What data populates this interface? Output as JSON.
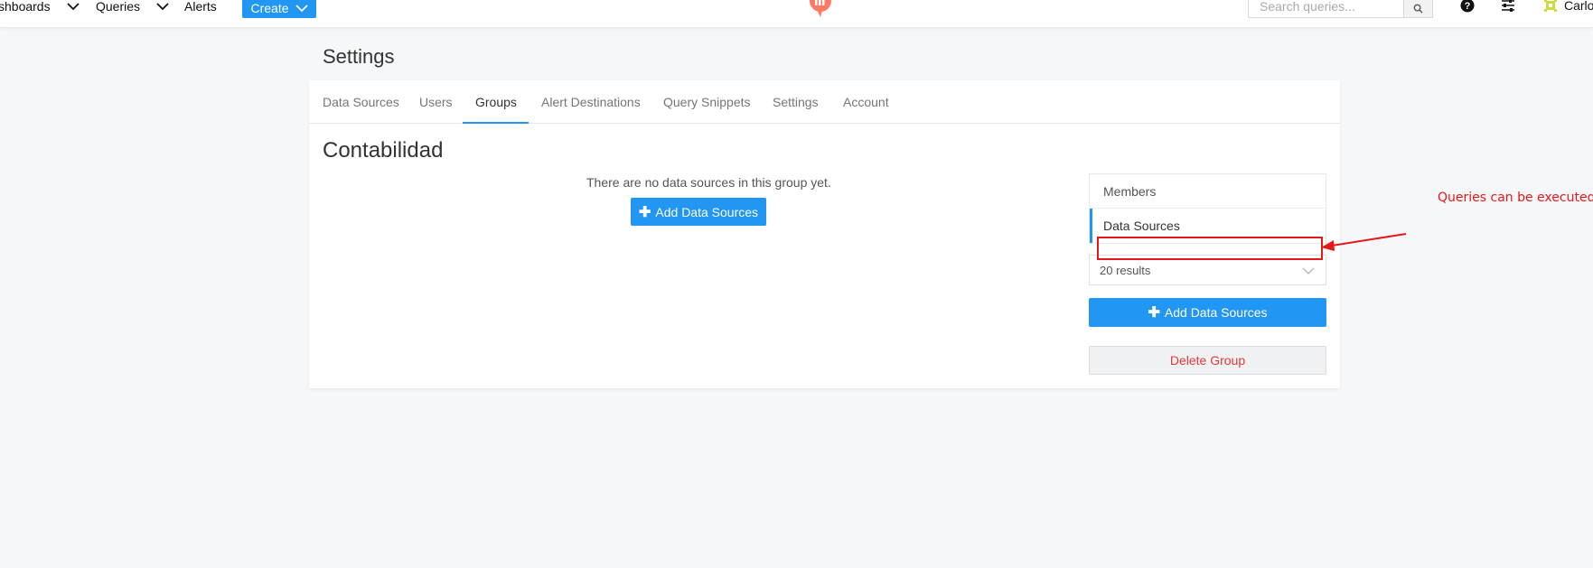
{
  "header": {
    "nav": [
      {
        "label": "shboards"
      },
      {
        "label": "Queries"
      },
      {
        "label": "Alerts"
      }
    ],
    "create_label": "Create",
    "search_placeholder": "Search queries...",
    "user_name": "Carlo"
  },
  "page": {
    "title": "Settings",
    "tabs": [
      {
        "label": "Data Sources"
      },
      {
        "label": "Users"
      },
      {
        "label": "Groups"
      },
      {
        "label": "Alert Destinations"
      },
      {
        "label": "Query Snippets"
      },
      {
        "label": "Settings"
      },
      {
        "label": "Account"
      }
    ],
    "active_tab": "Groups"
  },
  "group": {
    "name": "Contabilidad",
    "empty_message": "There are no data sources in this group yet.",
    "add_button_label": "Add Data Sources",
    "side_menu": [
      {
        "label": "Members"
      },
      {
        "label": "Data Sources"
      }
    ],
    "results_label": "20 results",
    "side_add_button_label": "Add Data Sources",
    "delete_button_label": "Delete Group"
  },
  "annotation": {
    "text": "Queries can be executed",
    "color": "#e81818"
  },
  "colors": {
    "accent": "#2196f3",
    "danger": "#e53935",
    "logo": "#ff7964"
  }
}
